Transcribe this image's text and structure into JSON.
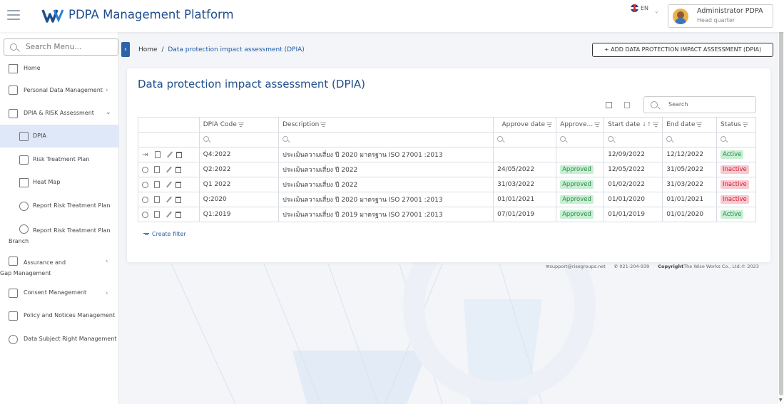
{
  "app": {
    "title": "PDPA Management Platform"
  },
  "header": {
    "lang": "EN",
    "user_name": "Administrator PDPA",
    "user_sub": "Head quarter"
  },
  "sidebar": {
    "search_placeholder": "Search Menu...",
    "items": [
      {
        "label": "Home",
        "icon": "home-icon"
      },
      {
        "label": "Personal Data Management",
        "icon": "person-data-icon"
      },
      {
        "label": "DPIA & RISK Assessment",
        "icon": "risk-icon"
      },
      {
        "label": "DPIA",
        "icon": "document-icon",
        "active": true
      },
      {
        "label": "Risk Treatment Plan",
        "icon": "document-icon"
      },
      {
        "label": "Heat Map",
        "icon": "grid-icon"
      },
      {
        "label": "Report Risk Treatment Plan",
        "icon": "pie-chart-icon"
      },
      {
        "label": "Report Risk Treatment Plan Branch",
        "icon": "pie-chart-icon"
      },
      {
        "label": "Assurance and Gap Management",
        "icon": "assurance-icon"
      },
      {
        "label": "Consent Management",
        "icon": "consent-icon"
      },
      {
        "label": "Policy and Notices Management",
        "icon": "policy-icon"
      },
      {
        "label": "Data Subject Right Management",
        "icon": "shield-icon"
      }
    ]
  },
  "breadcrumb": {
    "home": "Home",
    "sep": "/",
    "current": "Data protection impact assessment (DPIA)"
  },
  "add_button": "+ ADD DATA PROTECTION IMPACT ASSESSMENT (DPIA)",
  "card": {
    "title": "Data protection impact assessment (DPIA)",
    "search_placeholder": "Search"
  },
  "table": {
    "columns": [
      "DPIA Code",
      "Description",
      "Approve date",
      "Approve...",
      "Start date",
      "End date",
      "Status"
    ],
    "rows": [
      {
        "code": "Q4:2022",
        "desc": "ประเมินความเสี่ยง ปี 2020 มาตรฐาน ISO 27001 :2013",
        "approve_date": "",
        "approve": "",
        "start": "12/09/2022",
        "end": "12/12/2022",
        "status": "Active"
      },
      {
        "code": "Q2:2022",
        "desc": "ประเมินความเสี่ยง ปี 2022",
        "approve_date": "24/05/2022",
        "approve": "Approved",
        "start": "12/05/2022",
        "end": "31/05/2022",
        "status": "Inactive"
      },
      {
        "code": "Q1 2022",
        "desc": "ประเมินความเสี่ยง ปี 2022",
        "approve_date": "31/03/2022",
        "approve": "Approved",
        "start": "01/02/2022",
        "end": "31/03/2022",
        "status": "Inactive"
      },
      {
        "code": "Q:2020",
        "desc": "ประเมินความเสี่ยง ปี 2020 มาตรฐาน ISO 27001 :2013",
        "approve_date": "01/01/2021",
        "approve": "Approved",
        "start": "01/01/2020",
        "end": "01/01/2021",
        "status": "Inactive"
      },
      {
        "code": "Q1:2019",
        "desc": "ประเมินความเสี่ยง ปี 2019 มาตรฐาน ISO 27001 :2013",
        "approve_date": "07/01/2019",
        "approve": "Approved",
        "start": "01/01/2019",
        "end": "01/01/2020",
        "status": "Active"
      }
    ]
  },
  "create_filter": "Create filter",
  "footer": {
    "email": "support@risegroups.net",
    "phone": "021-204-939",
    "copyright_label": "Copyright",
    "copyright": "The Wise Works Co., Ltd.© 2023"
  },
  "colors": {
    "brand": "#1f4e8c",
    "accent": "#2d63a8",
    "active": "#2a8a4a",
    "inactive": "#d0203a"
  }
}
